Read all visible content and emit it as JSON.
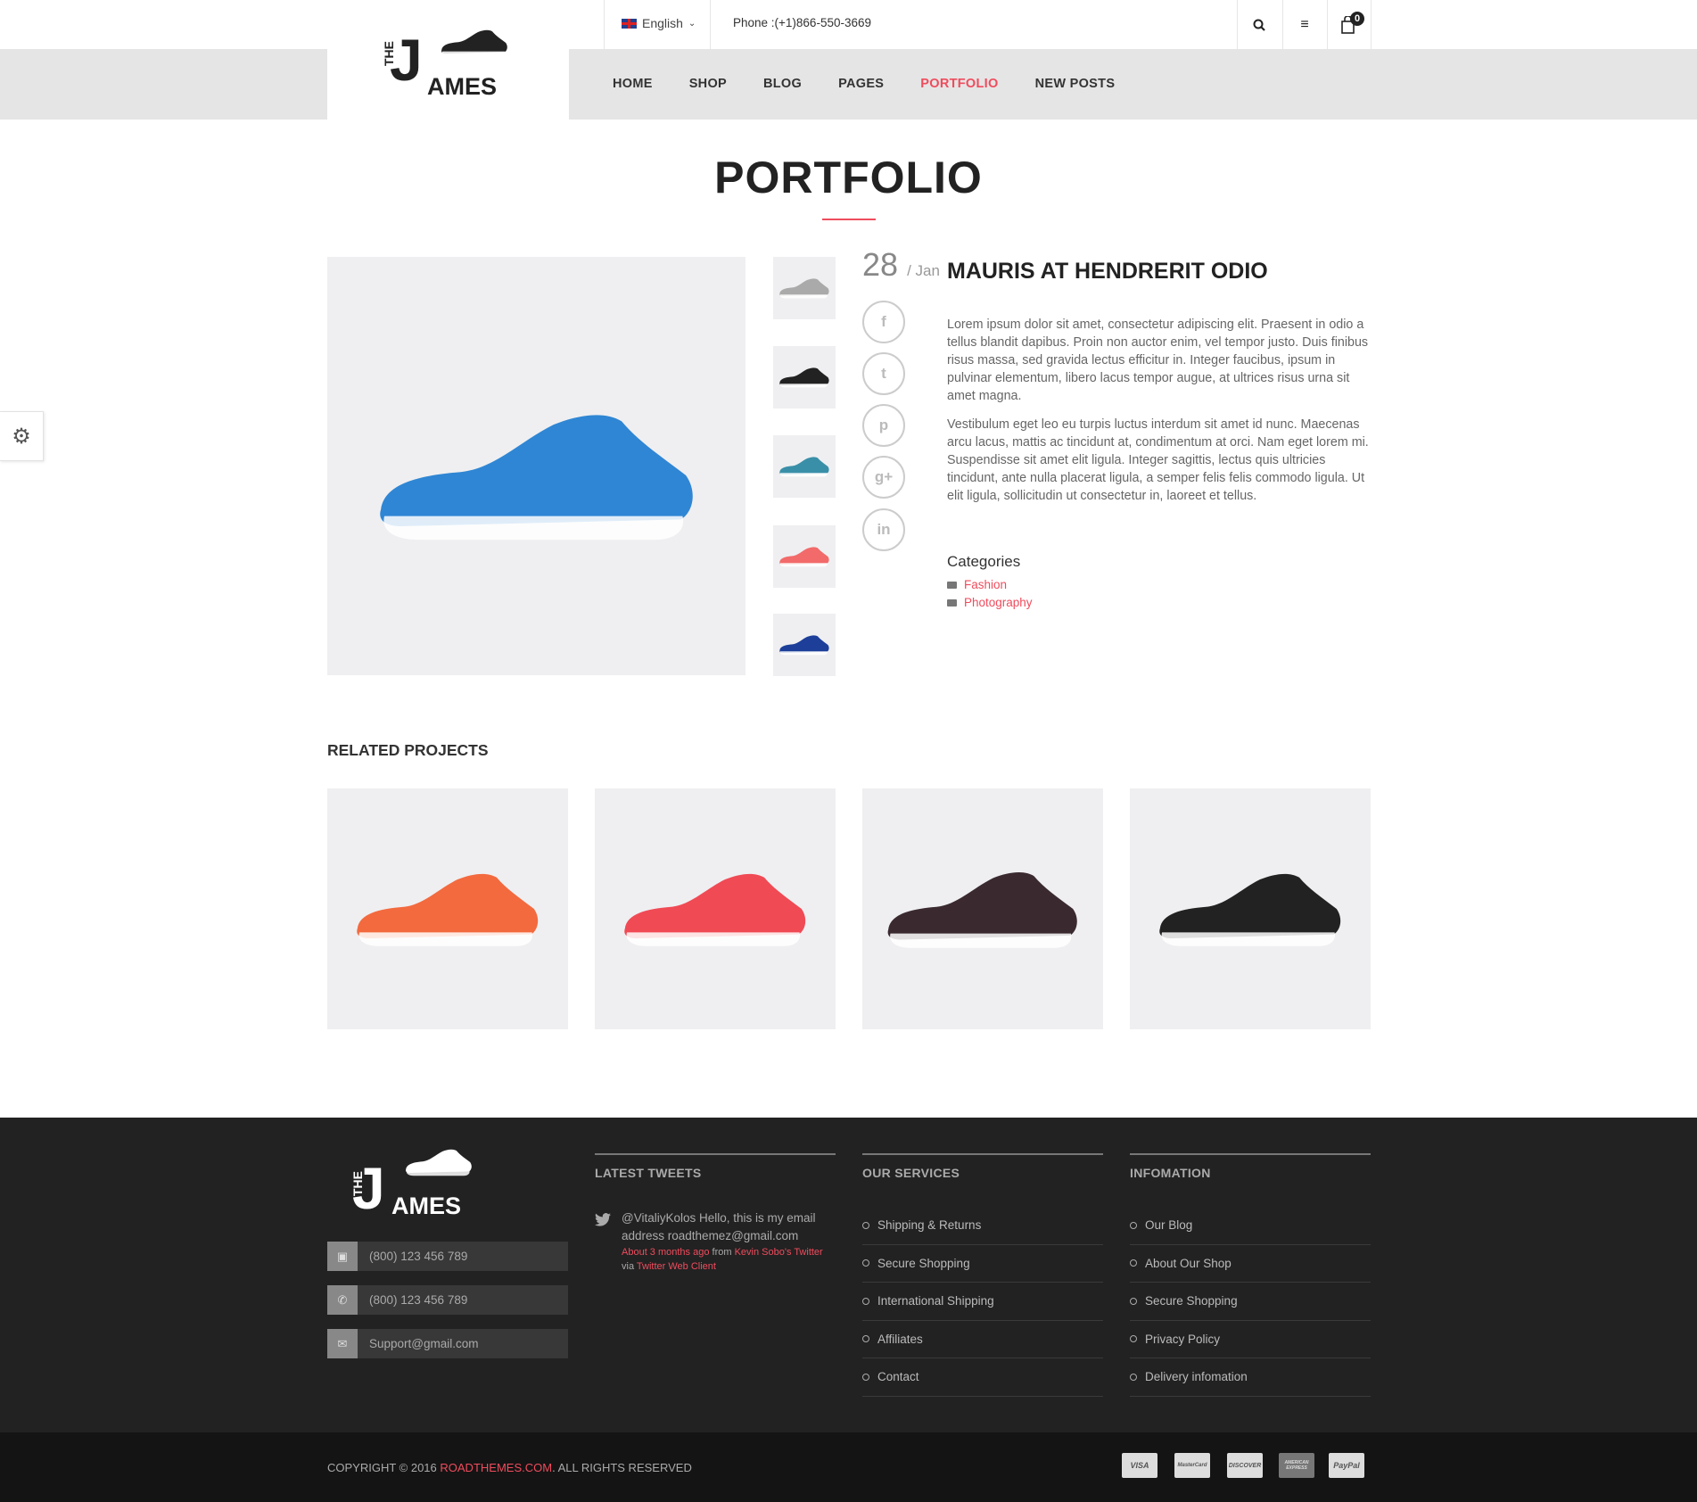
{
  "header": {
    "language": "English",
    "phone": "Phone :(+1)866-550-3669",
    "cart_count": "0",
    "logo": {
      "the": "THE",
      "j": "J",
      "ames": "AMES"
    }
  },
  "nav": [
    "HOME",
    "SHOP",
    "BLOG",
    "PAGES",
    "PORTFOLIO",
    "NEW POSTS"
  ],
  "nav_active": "PORTFOLIO",
  "page_title": "PORTFOLIO",
  "post": {
    "day": "28",
    "month": "/ Jan",
    "title": "MAURIS AT HENDRERIT ODIO",
    "paragraphs": [
      "Lorem ipsum dolor sit amet, consectetur adipiscing elit. Praesent in odio a tellus blandit dapibus. Proin non auctor enim, vel tempor justo. Duis finibus risus massa, sed gravida lectus efficitur in. Integer faucibus, ipsum in pulvinar elementum, libero lacus tempor augue, at ultrices risus urna sit amet magna.",
      "Vestibulum eget leo eu turpis luctus interdum sit amet id nunc. Maecenas arcu lacus, mattis ac tincidunt at, condimentum at orci. Nam eget lorem mi. Suspendisse sit amet elit ligula. Integer sagittis, lectus quis ultricies tincidunt, ante nulla placerat ligula, a semper felis felis commodo ligula. Ut elit ligula, sollicitudin ut consectetur in, laoreet et tellus."
    ],
    "categories_label": "Categories",
    "categories": [
      "Fashion",
      "Photography"
    ],
    "social": [
      "f",
      "t",
      "p",
      "g+",
      "in"
    ]
  },
  "related_heading": "RELATED PROJECTS",
  "footer": {
    "contacts": [
      "(800) 123 456 789",
      "(800) 123 456 789",
      "Support@gmail.com"
    ],
    "tweets_title": "LATEST TWEETS",
    "tweet": {
      "handle": "@VitaliyKolos",
      "text": " Hello, this is my email address roadthemez@gmail.com",
      "time": "About 3 months ago",
      "from": " from ",
      "source": "Kevin Sobo's Twitter",
      "via": "via ",
      "client": "Twitter Web Client"
    },
    "services_title": "OUR SERVICES",
    "services": [
      "Shipping & Returns",
      "Secure Shopping",
      "International Shipping",
      "Affiliates",
      "Contact"
    ],
    "info_title": "INFOMATION",
    "info": [
      "Our Blog",
      "About Our Shop",
      "Secure Shopping",
      "Privacy Policy",
      "Delivery infomation"
    ],
    "copyright_pre": "COPYRIGHT © 2016 ",
    "copyright_link": "ROADTHEMES.COM",
    "copyright_post": ". ALL RIGHTS RESERVED",
    "payments": [
      "VISA",
      "MasterCard",
      "DISCOVER",
      "AMERICAN EXPRESS",
      "PayPal"
    ]
  },
  "colors": {
    "accent": "#ef4c5d",
    "footer_bg": "#222222",
    "nav_bg": "#e5e5e5"
  }
}
